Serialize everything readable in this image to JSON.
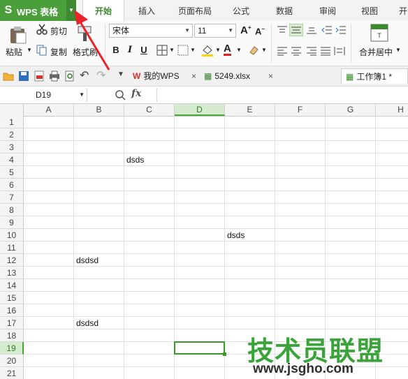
{
  "app": {
    "logo": "S",
    "title": "WPS 表格"
  },
  "menu_tabs": [
    "开始",
    "插入",
    "页面布局",
    "公式",
    "数据",
    "审阅",
    "视图",
    "开"
  ],
  "ribbon": {
    "paste_label": "粘贴",
    "cut_label": "剪切",
    "copy_label": "复制",
    "format_painter_label": "格式刷",
    "font_name": "宋体",
    "font_size": "11",
    "bold": "B",
    "italic": "I",
    "underline": "U",
    "font_color_letter": "A",
    "merge_label": "合并居中"
  },
  "doc_tabs": [
    {
      "label": "我的WPS",
      "close": "×"
    },
    {
      "label": "5249.xlsx",
      "close": "×"
    },
    {
      "label": "工作簿1 *"
    }
  ],
  "formula_bar": {
    "name_box": "D19",
    "fx": "fx",
    "zoom_icon": "magnifier-icon"
  },
  "columns": [
    "A",
    "B",
    "C",
    "D",
    "E",
    "F",
    "G",
    "H"
  ],
  "selected_column": "D",
  "rows": [
    "1",
    "2",
    "3",
    "4",
    "5",
    "6",
    "7",
    "8",
    "9",
    "10",
    "11",
    "12",
    "13",
    "14",
    "15",
    "16",
    "17",
    "18",
    "19",
    "20",
    "21"
  ],
  "selected_row": "19",
  "cells": [
    {
      "ref": "C4",
      "value": "dsds"
    },
    {
      "ref": "E10",
      "value": "dsds"
    },
    {
      "ref": "B12",
      "value": "dsdsd"
    },
    {
      "ref": "B17",
      "value": "dsdsd"
    }
  ],
  "watermark": {
    "line1": "技术员联盟",
    "line2": "www.jsgho.com"
  },
  "colors": {
    "accent": "#4b9f3b",
    "annotation": "#e8232a"
  }
}
